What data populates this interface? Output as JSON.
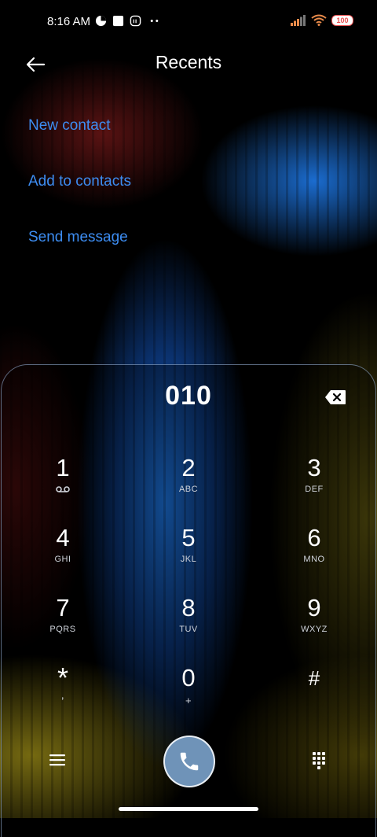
{
  "status_bar": {
    "time": "8:16 AM",
    "battery": "100"
  },
  "header": {
    "title": "Recents"
  },
  "actions": [
    {
      "label": "New contact"
    },
    {
      "label": "Add to contacts"
    },
    {
      "label": "Send message"
    }
  ],
  "dialer": {
    "number": "010",
    "keys": [
      {
        "digit": "1",
        "letters": ""
      },
      {
        "digit": "2",
        "letters": "ABC"
      },
      {
        "digit": "3",
        "letters": "DEF"
      },
      {
        "digit": "4",
        "letters": "GHI"
      },
      {
        "digit": "5",
        "letters": "JKL"
      },
      {
        "digit": "6",
        "letters": "MNO"
      },
      {
        "digit": "7",
        "letters": "PQRS"
      },
      {
        "digit": "8",
        "letters": "TUV"
      },
      {
        "digit": "9",
        "letters": "WXYZ"
      },
      {
        "digit": "*",
        "letters": ","
      },
      {
        "digit": "0",
        "letters": "+"
      },
      {
        "digit": "#",
        "letters": ""
      }
    ]
  },
  "icons": {
    "back": "arrow-left-icon",
    "backspace": "backspace-icon",
    "menu": "menu-icon",
    "call": "phone-icon",
    "dialpad": "dialpad-icon",
    "voicemail": "voicemail-icon"
  },
  "colors": {
    "accent": "#3d8df2",
    "call_button": "#6f93b8"
  }
}
